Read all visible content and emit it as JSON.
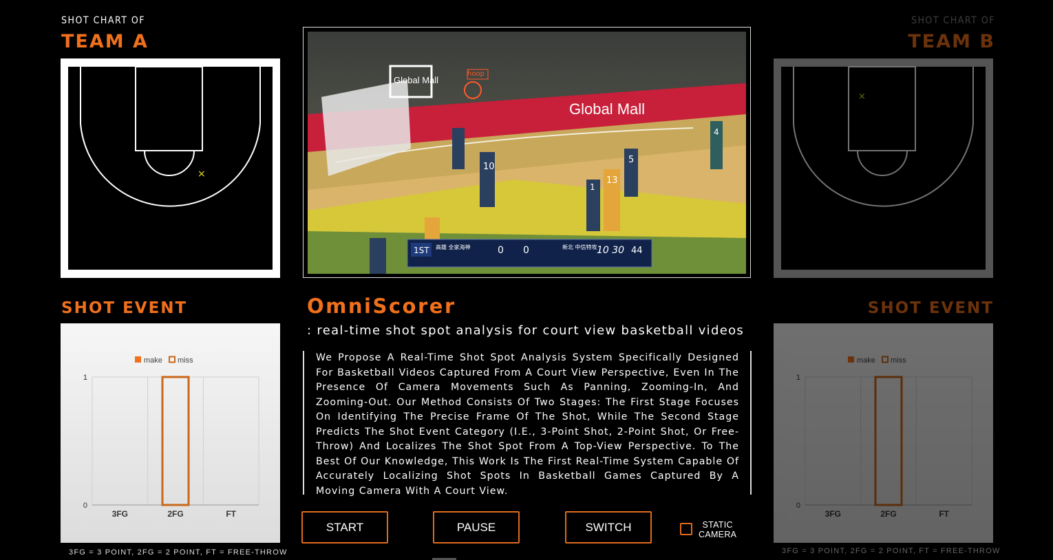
{
  "team_a": {
    "subtitle": "SHOT CHART OF",
    "title": "TEAM A",
    "shot_event_title": "SHOT EVENT",
    "footnote": "3FG = 3 POINT, 2FG = 2 POINT, FT = FREE-THROW"
  },
  "team_b": {
    "subtitle": "SHOT CHART OF",
    "title": "TEAM B",
    "shot_event_title": "SHOT EVENT",
    "footnote": "3FG = 3 POINT, 2FG = 2 POINT, FT = FREE-THROW"
  },
  "main": {
    "app_title": "OmniScorer",
    "tagline": ": real-time shot spot analysis for court view basketball videos",
    "description": "We Propose A Real-Time Shot Spot Analysis System Specifically Designed For Basketball Videos Captured From A Court View Perspective, Even In The Presence Of Camera Movements Such As Panning, Zooming-In, And Zooming-Out. Our Method Consists Of Two Stages: The First Stage Focuses On Identifying The Precise Frame Of The Shot, While The Second Stage Predicts The Shot Event Category (I.E., 3-Point Shot, 2-Point Shot, Or Free-Throw) And Localizes The Shot Spot From A Top-View Perspective. To The Best Of Our Knowledge, This Work Is The First Real-Time System Capable Of Accurately Localizing Shot Spots In Basketball Games Captured By A Moving Camera With A Court View."
  },
  "video": {
    "ad_text_1": "Global Mall",
    "ad_text_2": "Global Mall",
    "hoop_label": "hoop",
    "scoreboard": {
      "period": "1ST",
      "home_team": "高雄 全家海神",
      "home_score": "0",
      "away_score": "0",
      "away_team": "新北 中信特攻",
      "game_clock": "10 30",
      "shot_clock": "44"
    },
    "jersey_numbers": [
      "10",
      "13",
      "5",
      "1",
      "4"
    ]
  },
  "controls": {
    "start_label": "START",
    "pause_label": "PAUSE",
    "switch_label": "SWITCH",
    "static_camera_label_1": "STATIC",
    "static_camera_label_2": "CAMERA",
    "static_camera_checked": false
  },
  "shot_marks": {
    "team_a": {
      "symbol": "×",
      "color": "#e6e619"
    },
    "team_b": {
      "symbol": "×",
      "color": "#e6e619"
    }
  },
  "colors": {
    "accent": "#f0701c",
    "make": "#f0701c",
    "miss": "#c9671a"
  },
  "chart_data": [
    {
      "type": "bar",
      "categories": [
        "3FG",
        "2FG",
        "FT"
      ],
      "series": [
        {
          "name": "make",
          "values": [
            0,
            0,
            0
          ]
        },
        {
          "name": "miss",
          "values": [
            0,
            1,
            0
          ]
        }
      ],
      "ylim": [
        0,
        1
      ],
      "yticks": [
        "0",
        "1"
      ],
      "legend": "top",
      "grid": true
    },
    {
      "type": "bar",
      "categories": [
        "3FG",
        "2FG",
        "FT"
      ],
      "series": [
        {
          "name": "make",
          "values": [
            0,
            0,
            0
          ]
        },
        {
          "name": "miss",
          "values": [
            0,
            1,
            0
          ]
        }
      ],
      "ylim": [
        0,
        1
      ],
      "yticks": [
        "0",
        "1"
      ],
      "legend": "top",
      "grid": true
    }
  ]
}
